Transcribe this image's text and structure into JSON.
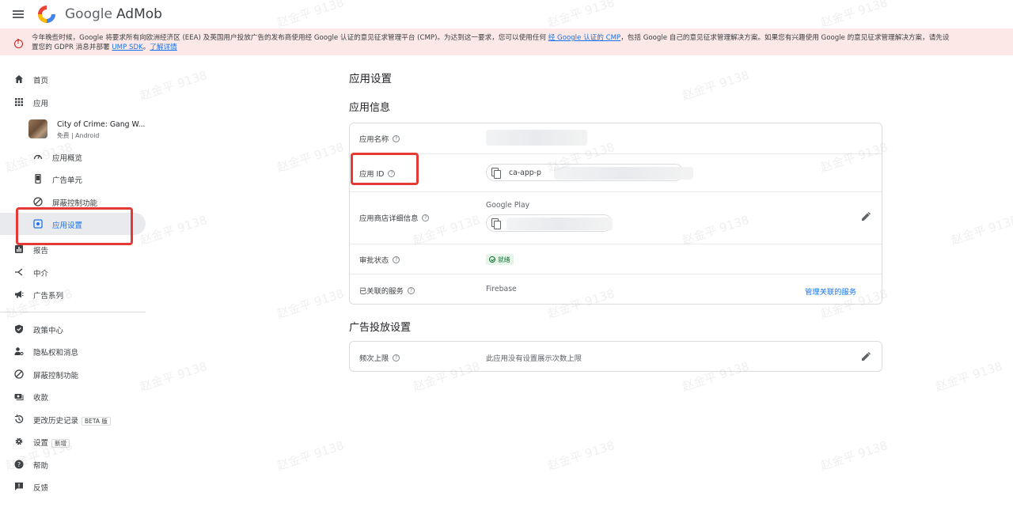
{
  "header": {
    "brand_google": "Google",
    "brand_product": "AdMob"
  },
  "banner": {
    "line1_text": "今年晚些时候，Google 将要求所有向欧洲经济区 (EEA) 及英国用户投放广告的发布商使用经 Google 认证的意见征求管理平台 (CMP)。为达到这一要求，您可以使用任何",
    "line1_link": "经 Google 认证的 CMP",
    "line1_tail": "，包括 Google 自己的意见征求管理解决方案。如果您有兴趣使用 Google 的意见征求管理解决方案，请先设",
    "line2_text": "置您的 GDPR 消息并部署",
    "line2_link1": "UMP SDK",
    "line2_sep": "。",
    "line2_link2": "了解详情"
  },
  "sidebar": {
    "home": "首页",
    "apps": "应用",
    "app": {
      "name": "City of Crime: Gang W...",
      "meta": "免费 | Android"
    },
    "overview": "应用概览",
    "ad_units": "广告单元",
    "blocking": "屏蔽控制功能",
    "app_settings": "应用设置",
    "reports": "报告",
    "mediation": "中介",
    "campaigns": "广告系列",
    "policy_center": "政策中心",
    "privacy": "隐私权和消息",
    "blocking2": "屏蔽控制功能",
    "payments": "收款",
    "change_history": "更改历史记录",
    "change_history_badge": "BETA 版",
    "settings": "设置",
    "settings_badge": "新增",
    "help": "帮助",
    "feedback": "反馈"
  },
  "main": {
    "title": "应用设置",
    "app_info": {
      "title": "应用信息",
      "app_name_label": "应用名称",
      "app_id_label": "应用 ID",
      "app_id_value": "ca-app-p",
      "store_label": "应用商店详细信息",
      "store_value": "Google Play",
      "approval_label": "审批状态",
      "approval_value": "就绪",
      "linked_label": "已关联的服务",
      "linked_value": "Firebase",
      "manage_link": "管理关联的服务"
    },
    "ad_serving": {
      "title": "广告投放设置",
      "freq_label": "频次上限",
      "freq_value": "此应用没有设置展示次数上限"
    }
  },
  "watermark": "赵金平 9138",
  "colors": {
    "accent": "#1a73e8",
    "highlight": "#e53935",
    "banner_bg": "#fce8e6",
    "ready": "#137333"
  }
}
